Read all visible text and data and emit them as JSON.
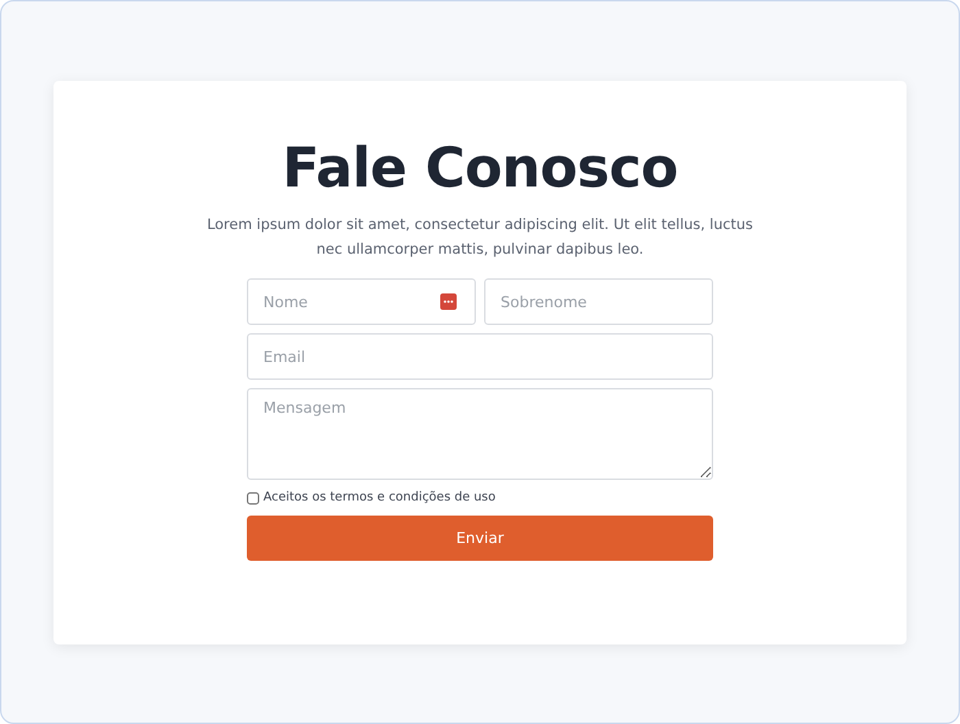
{
  "title": "Fale Conosco",
  "description": "Lorem ipsum dolor sit amet, consectetur adipiscing elit. Ut elit tellus, luctus nec ullamcorper mattis, pulvinar dapibus leo.",
  "fields": [
    {
      "kind": "input",
      "placeholder": "Nome",
      "autofill_icon": true
    },
    {
      "kind": "input",
      "placeholder": "Sobrenome",
      "autofill_icon": false
    }
  ],
  "email": {
    "placeholder": "Email"
  },
  "message": {
    "placeholder": "Mensagem"
  },
  "terms": {
    "label": "Aceitos os termos e condições de uso",
    "checked": false
  },
  "submit": {
    "label": "Enviar"
  }
}
